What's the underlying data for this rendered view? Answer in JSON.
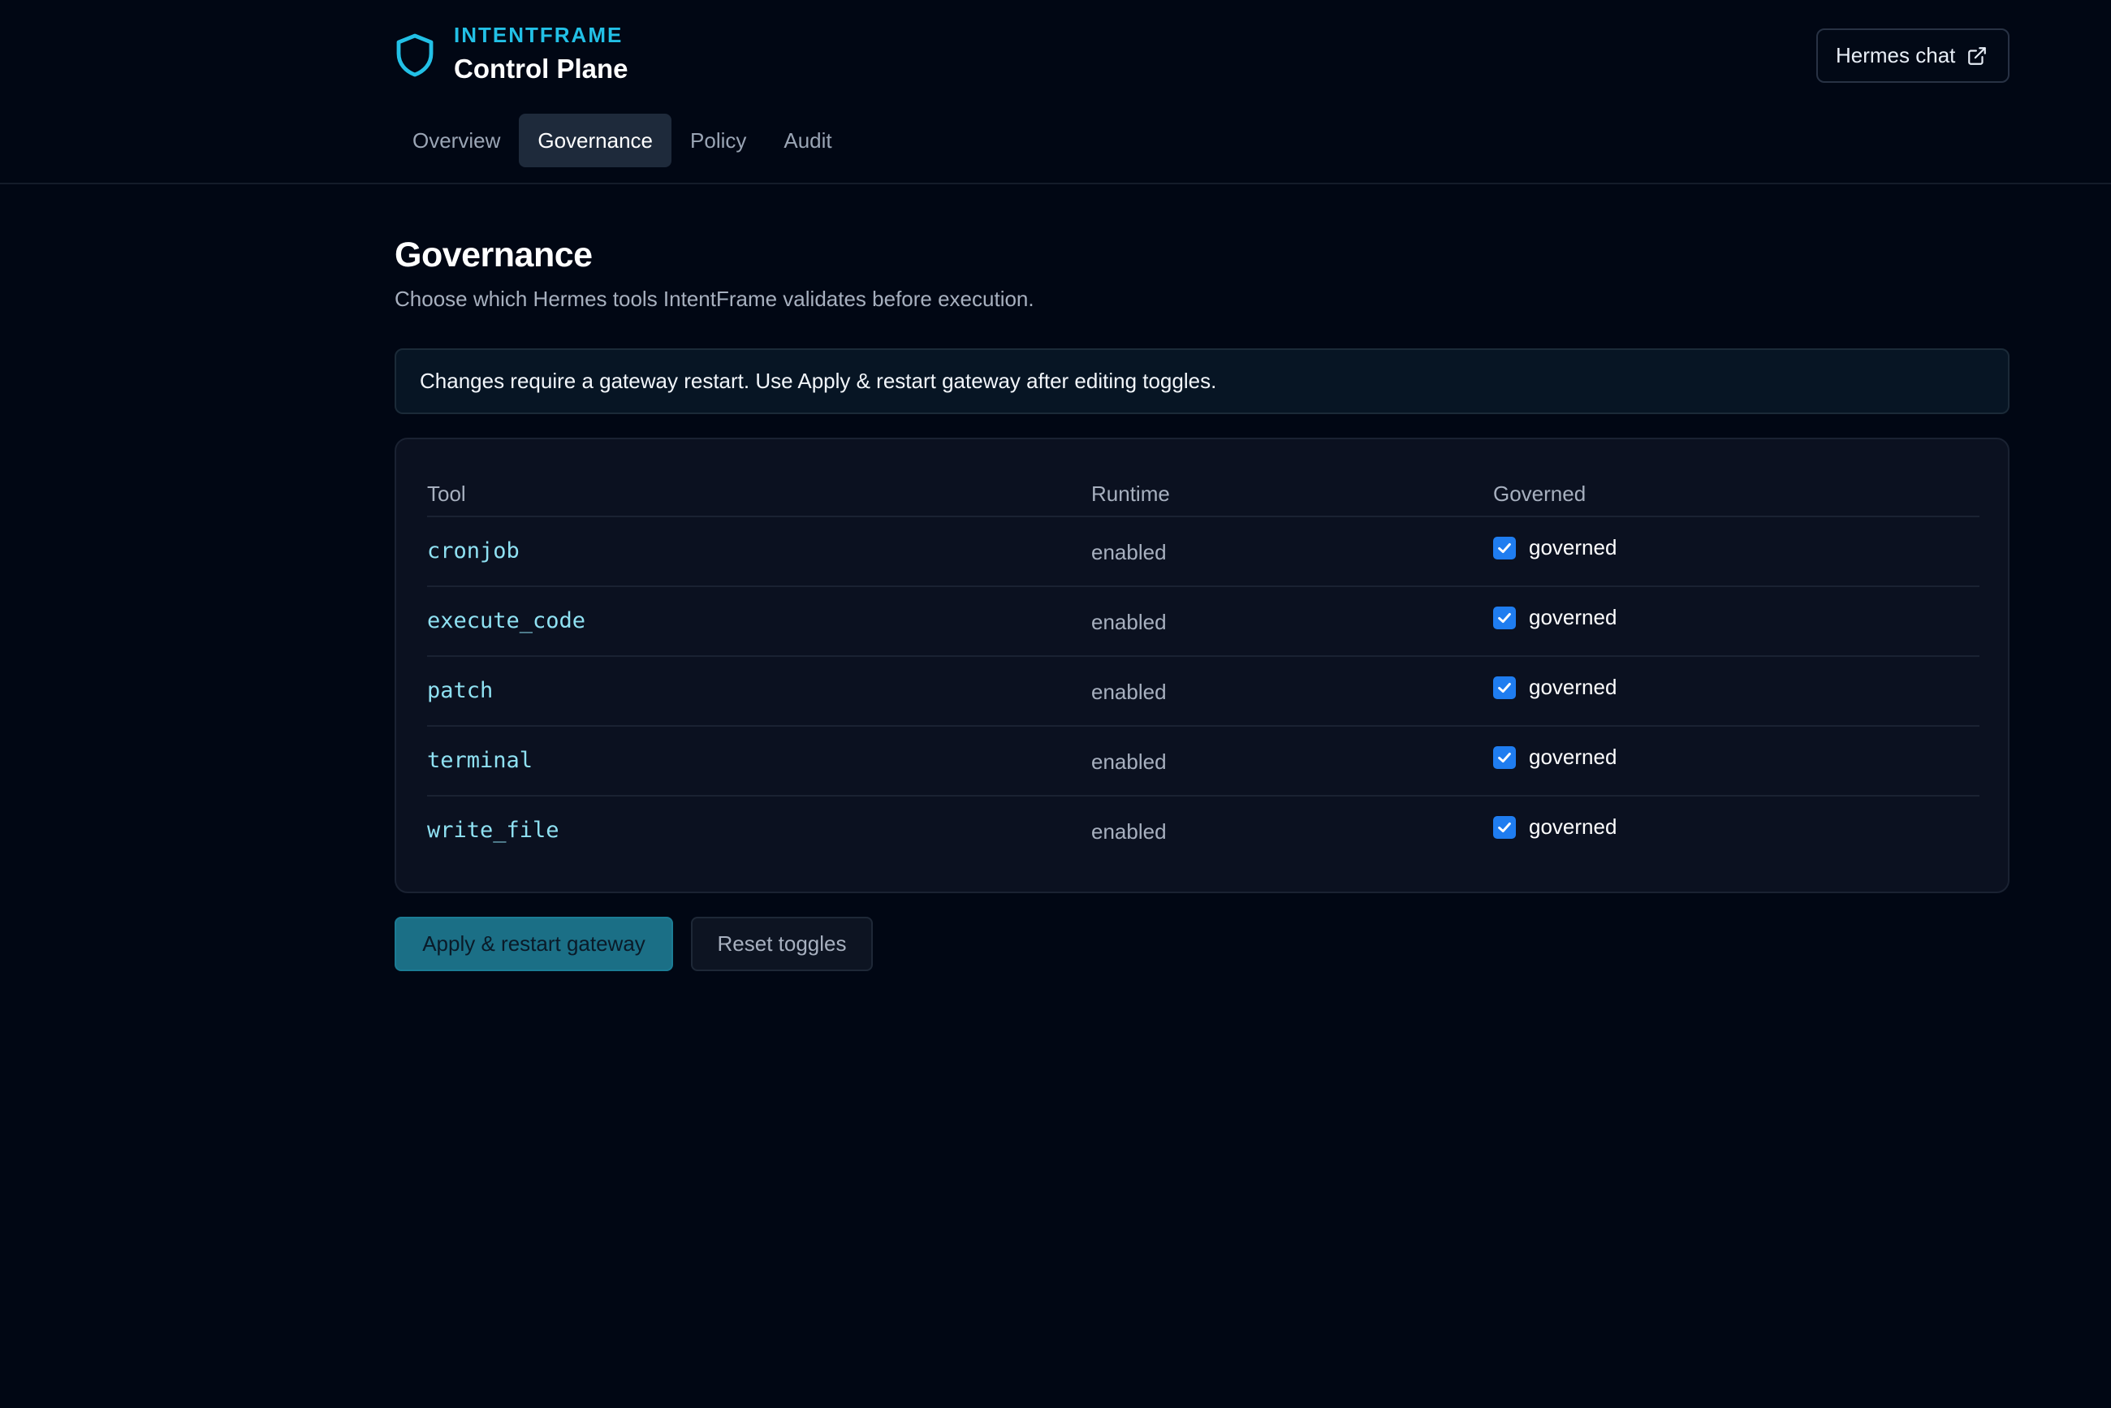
{
  "header": {
    "brand": "INTENTFRAME",
    "app_title": "Control Plane",
    "logo_icon": "shield-icon",
    "external_link": {
      "label": "Hermes chat",
      "icon": "external-link-icon"
    }
  },
  "tabs": [
    {
      "label": "Overview",
      "active": false
    },
    {
      "label": "Governance",
      "active": true
    },
    {
      "label": "Policy",
      "active": false
    },
    {
      "label": "Audit",
      "active": false
    }
  ],
  "page": {
    "title": "Governance",
    "subtitle": "Choose which Hermes tools IntentFrame validates before execution.",
    "notice": "Changes require a gateway restart. Use Apply & restart gateway after editing toggles."
  },
  "table": {
    "headers": {
      "tool": "Tool",
      "runtime": "Runtime",
      "governed": "Governed"
    },
    "rows": [
      {
        "tool": "cronjob",
        "runtime": "enabled",
        "governed": true,
        "governed_label": "governed"
      },
      {
        "tool": "execute_code",
        "runtime": "enabled",
        "governed": true,
        "governed_label": "governed"
      },
      {
        "tool": "patch",
        "runtime": "enabled",
        "governed": true,
        "governed_label": "governed"
      },
      {
        "tool": "terminal",
        "runtime": "enabled",
        "governed": true,
        "governed_label": "governed"
      },
      {
        "tool": "write_file",
        "runtime": "enabled",
        "governed": true,
        "governed_label": "governed"
      }
    ]
  },
  "actions": {
    "apply_label": "Apply & restart gateway",
    "reset_label": "Reset toggles"
  },
  "colors": {
    "background": "#010714",
    "accent": "#22c0e6",
    "primary_button": "#1b6f86",
    "checkbox": "#1f7df0",
    "tool_text": "#8fe1f2"
  }
}
